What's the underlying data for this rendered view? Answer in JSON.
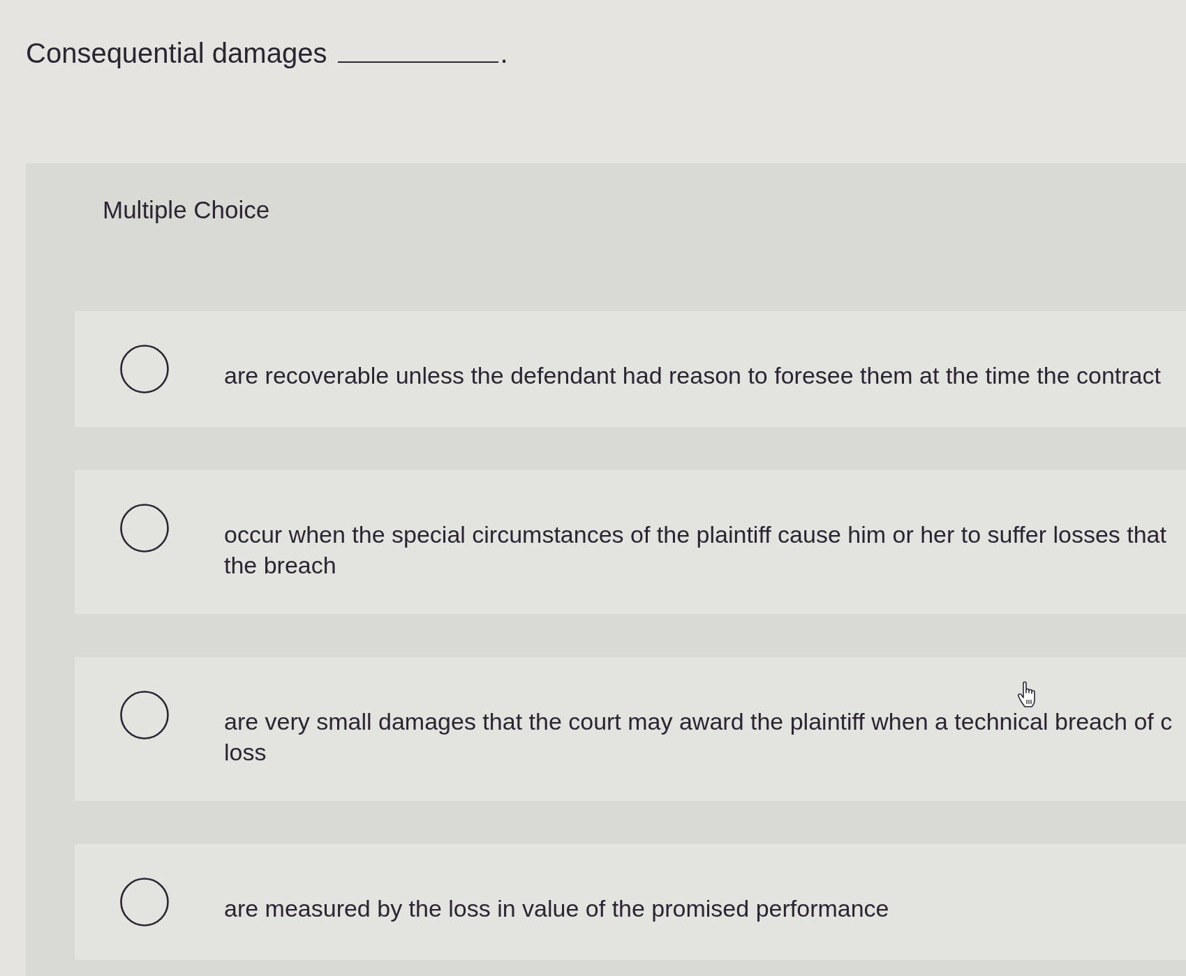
{
  "question": {
    "text": "Consequential damages",
    "after_blank": "."
  },
  "panel": {
    "heading": "Multiple Choice"
  },
  "choices": [
    {
      "lines": [
        "are recoverable unless the defendant had reason to foresee them at the time the contract"
      ],
      "selected": false
    },
    {
      "lines": [
        "occur when the special circumstances of the plaintiff cause him or her to suffer losses that",
        "the breach"
      ],
      "selected": false
    },
    {
      "lines": [
        "are very small damages that the court may award the plaintiff when a technical breach of c",
        "loss"
      ],
      "selected": false
    },
    {
      "lines": [
        "are measured by the loss in value of the promised performance"
      ],
      "selected": false
    }
  ]
}
